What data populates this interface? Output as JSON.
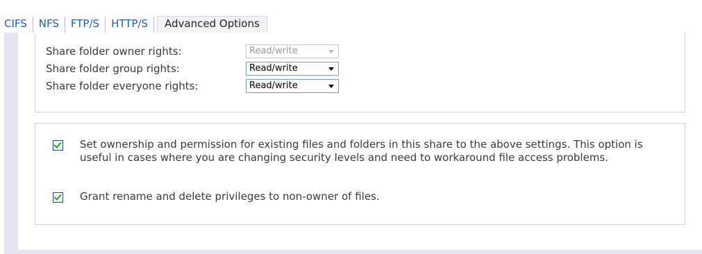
{
  "tabs": [
    {
      "label": "CIFS"
    },
    {
      "label": "NFS"
    },
    {
      "label": "FTP/S"
    },
    {
      "label": "HTTP/S"
    },
    {
      "label": "Advanced Options",
      "active": true
    }
  ],
  "rights": [
    {
      "label": "Share folder owner rights:",
      "value": "Read/write",
      "disabled": true
    },
    {
      "label": "Share folder group rights:",
      "value": "Read/write",
      "disabled": false
    },
    {
      "label": "Share folder everyone rights:",
      "value": "Read/write",
      "disabled": false
    }
  ],
  "options": [
    {
      "checked": true,
      "text": "Set ownership and permission for existing files and folders in this share to the above settings. This option is useful in cases where you are changing security levels and need to workaround file access problems."
    },
    {
      "checked": true,
      "text": "Grant rename and delete privileges to non-owner of files."
    }
  ],
  "icons": {
    "dropdown": "chevron-down-icon",
    "checkbox": "checkmark-icon"
  }
}
